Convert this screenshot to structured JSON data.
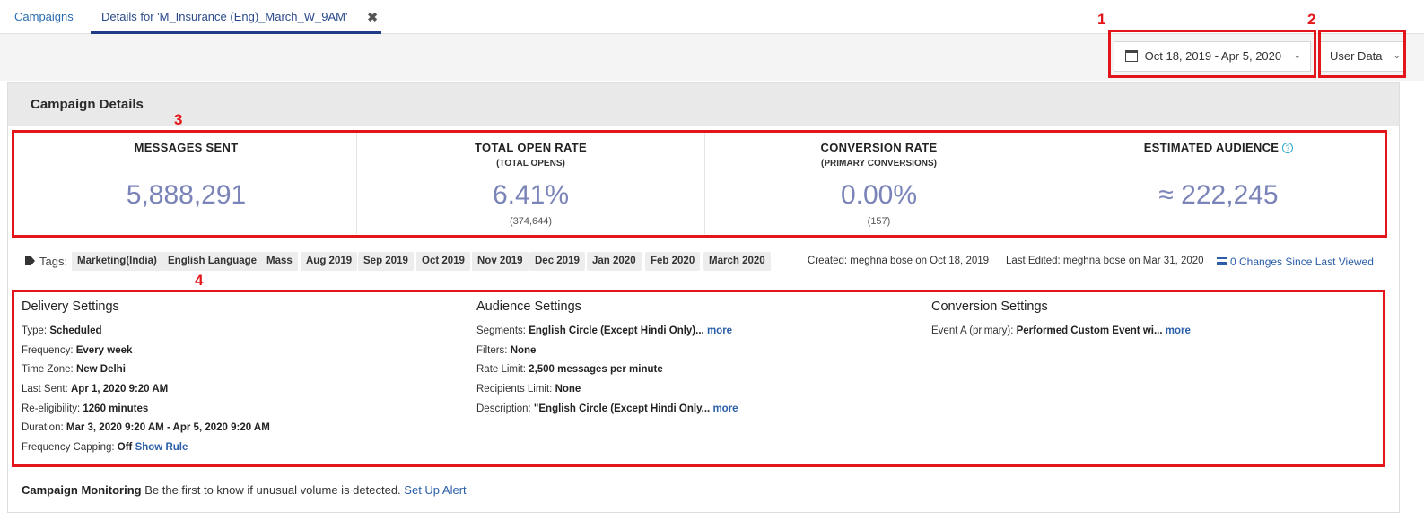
{
  "tabs": {
    "campaigns": "Campaigns",
    "details": "Details for 'M_Insurance (Eng)_March_W_9AM'",
    "close_glyph": "✖"
  },
  "toolbar": {
    "date_range": "Oct 18, 2019 - Apr 5, 2020",
    "user_data": "User Data",
    "chevron": "⌄"
  },
  "callouts": {
    "one": "1",
    "two": "2",
    "three": "3",
    "four": "4",
    "color": "#e3151a"
  },
  "panel": {
    "title": "Campaign Details"
  },
  "stats": [
    {
      "label": "MESSAGES SENT",
      "sub": "",
      "value": "5,888,291",
      "note": ""
    },
    {
      "label": "TOTAL OPEN RATE",
      "sub": "(TOTAL OPENS)",
      "value": "6.41%",
      "note": "(374,644)"
    },
    {
      "label": "CONVERSION RATE",
      "sub": "(PRIMARY CONVERSIONS)",
      "value": "0.00%",
      "note": "(157)"
    },
    {
      "label": "ESTIMATED AUDIENCE",
      "sub": "",
      "value": "≈ 222,245",
      "note": "",
      "help_icon": "?"
    }
  ],
  "tags": {
    "label": "Tags:",
    "items": [
      "Marketing(India)",
      "English Language",
      "Mass",
      "Aug 2019",
      "Sep 2019",
      "Oct 2019",
      "Nov 2019",
      "Dec 2019",
      "Jan 2020",
      "Feb 2020",
      "March 2020"
    ],
    "created": "Created: meghna bose on Oct 18, 2019",
    "last_edited": "Last Edited: meghna bose on Mar 31, 2020",
    "changes": "0 Changes Since Last Viewed"
  },
  "delivery": {
    "title": "Delivery Settings",
    "rows": [
      {
        "label": "Type:",
        "value": "Scheduled"
      },
      {
        "label": "Frequency:",
        "value": "Every week"
      },
      {
        "label": "Time Zone:",
        "value": "New Delhi"
      },
      {
        "label": "Last Sent:",
        "value": "Apr 1, 2020 9:20 AM"
      },
      {
        "label": "Re-eligibility:",
        "value": "1260 minutes"
      },
      {
        "label": "Duration:",
        "value": "Mar 3, 2020 9:20 AM - Apr 5, 2020 9:20 AM"
      },
      {
        "label": "Frequency Capping:",
        "value": "Off",
        "link": "Show Rule"
      }
    ]
  },
  "audience": {
    "title": "Audience Settings",
    "rows": [
      {
        "label": "Segments:",
        "value": "English Circle (Except Hindi Only)...",
        "link": "more"
      },
      {
        "label": "Filters:",
        "value": "None"
      },
      {
        "label": "Rate Limit:",
        "value": "2,500 messages per minute"
      },
      {
        "label": "Recipients Limit:",
        "value": "None"
      },
      {
        "label": "Description:",
        "value": "\"English Circle (Except Hindi Only...",
        "link": "more"
      }
    ]
  },
  "conversion": {
    "title": "Conversion Settings",
    "rows": [
      {
        "label": "Event A (primary):",
        "value": "Performed Custom Event wi...",
        "link": "more"
      }
    ]
  },
  "monitoring": {
    "title": "Campaign Monitoring",
    "text": "Be the first to know if unusual volume is detected.",
    "link": "Set Up Alert"
  }
}
